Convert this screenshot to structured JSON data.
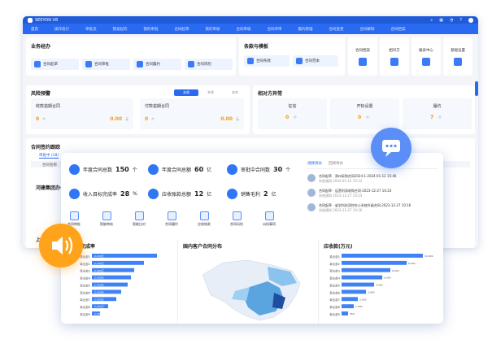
{
  "app": {
    "title": "SEEYON V8"
  },
  "nav": {
    "items": [
      "首页",
      "操作指引",
      "审批流",
      "我发起的",
      "我的审批",
      "合同起草",
      "我的审核",
      "合同审核",
      "合同评审",
      "履约管理",
      "合同变更",
      "合同解除",
      "合同档案"
    ]
  },
  "business": {
    "title": "业务经办",
    "buttons": [
      "合同起草",
      "合同审批",
      "合同履约",
      "合同风险"
    ]
  },
  "terms": {
    "title": "条款与模板",
    "buttons": [
      "合同条款",
      "合同范本"
    ]
  },
  "shortcuts": [
    "合同档案",
    "相对方",
    "报表中心",
    "基础设置"
  ],
  "risk": {
    "title": "风险预警",
    "tabs": [
      "本周",
      "本季",
      "本年"
    ],
    "cards": [
      {
        "label": "收款逾期合同",
        "value": "0",
        "unit": "个",
        "amount": "0.00",
        "amount_unit": "元"
      },
      {
        "label": "付款逾期合同",
        "value": "0",
        "unit": "个",
        "amount": "0.00",
        "amount_unit": "元"
      }
    ]
  },
  "counterparty": {
    "title": "相对方异常",
    "cards": [
      {
        "label": "征信",
        "value": "0",
        "unit": "个"
      },
      {
        "label": "开标设置",
        "value": "0",
        "unit": "个"
      },
      {
        "label": "履约",
        "value": "7",
        "unit": "个"
      }
    ]
  },
  "tracking": {
    "title": "合同签约跟踪",
    "tabs": [
      "审批中 (18)",
      "签署中 (1)",
      "已签约 (0)"
    ],
    "col_name": "合同名称",
    "row1": "河建集团办公",
    "row2": "上"
  },
  "kpis": [
    {
      "label": "年度合同总数",
      "value": "150",
      "unit": "个"
    },
    {
      "label": "年度合同总额",
      "value": "60",
      "unit": "亿"
    },
    {
      "label": "审批中合同数",
      "value": "30",
      "unit": "个"
    },
    {
      "label": "收入目标完成率",
      "value": "28",
      "unit": "%"
    },
    {
      "label": "应收账款总额",
      "value": "12",
      "unit": "亿"
    },
    {
      "label": "销售毛利",
      "value": "2",
      "unit": "亿"
    }
  ],
  "quicklinks": [
    "合同审批",
    "智能审核",
    "智能比对",
    "合同履约",
    "应收账款",
    "合同风险",
    "纠纷事项"
  ],
  "feed": {
    "tabs": [
      "视频待办",
      "回顾待办"
    ],
    "items": [
      {
        "text": "合同起草 · 郑州采购合同2024-1-2024-01-12 15:46",
        "meta": "系统通知 2024-01-12 15:12"
      },
      {
        "text": "合同起草 · 运营利润收购合同-2023-12-27 10:24",
        "meta": "系统通知 2023-12-27 10:24"
      },
      {
        "text": "合同起草 · 省学科技双控办公系统升级合同-2023-12-27 10:16",
        "meta": "系统通知 2023-12-27 10:16"
      }
    ]
  },
  "charts": {
    "left_title": "收入完成率",
    "map_title": "国内客户合同分布",
    "right_title": "应收款(万元)"
  },
  "chart_data": [
    {
      "type": "bar",
      "title": "收入完成率",
      "categories": [
        "事业部1",
        "事业部2",
        "事业部3",
        "事业部4",
        "事业部5",
        "事业部6",
        "事业部7",
        "事业部8",
        "事业部9"
      ],
      "values": [
        40,
        32,
        26,
        24,
        22,
        18,
        15,
        10,
        5
      ],
      "labels": [
        "2,430万",
        "2,430万",
        "2,430万",
        "2,430万",
        "2,430万",
        "2,430万",
        "2,430万",
        "2,430万",
        "2,430万"
      ],
      "xlim": [
        0,
        45
      ]
    },
    {
      "type": "bar",
      "title": "应收款(万元)",
      "categories": [
        "事业部1",
        "事业部2",
        "事业部3",
        "事业部4",
        "事业部5",
        "事业部6",
        "事业部7",
        "事业部8",
        "事业部9"
      ],
      "values": [
        10000,
        8000,
        6000,
        5000,
        4000,
        3000,
        2000,
        1500,
        800
      ],
      "xlim": [
        0,
        11000
      ]
    }
  ],
  "colors": {
    "primary": "#2a6af0",
    "accent": "#ffa31a",
    "bubble": "#5b8ef6"
  }
}
